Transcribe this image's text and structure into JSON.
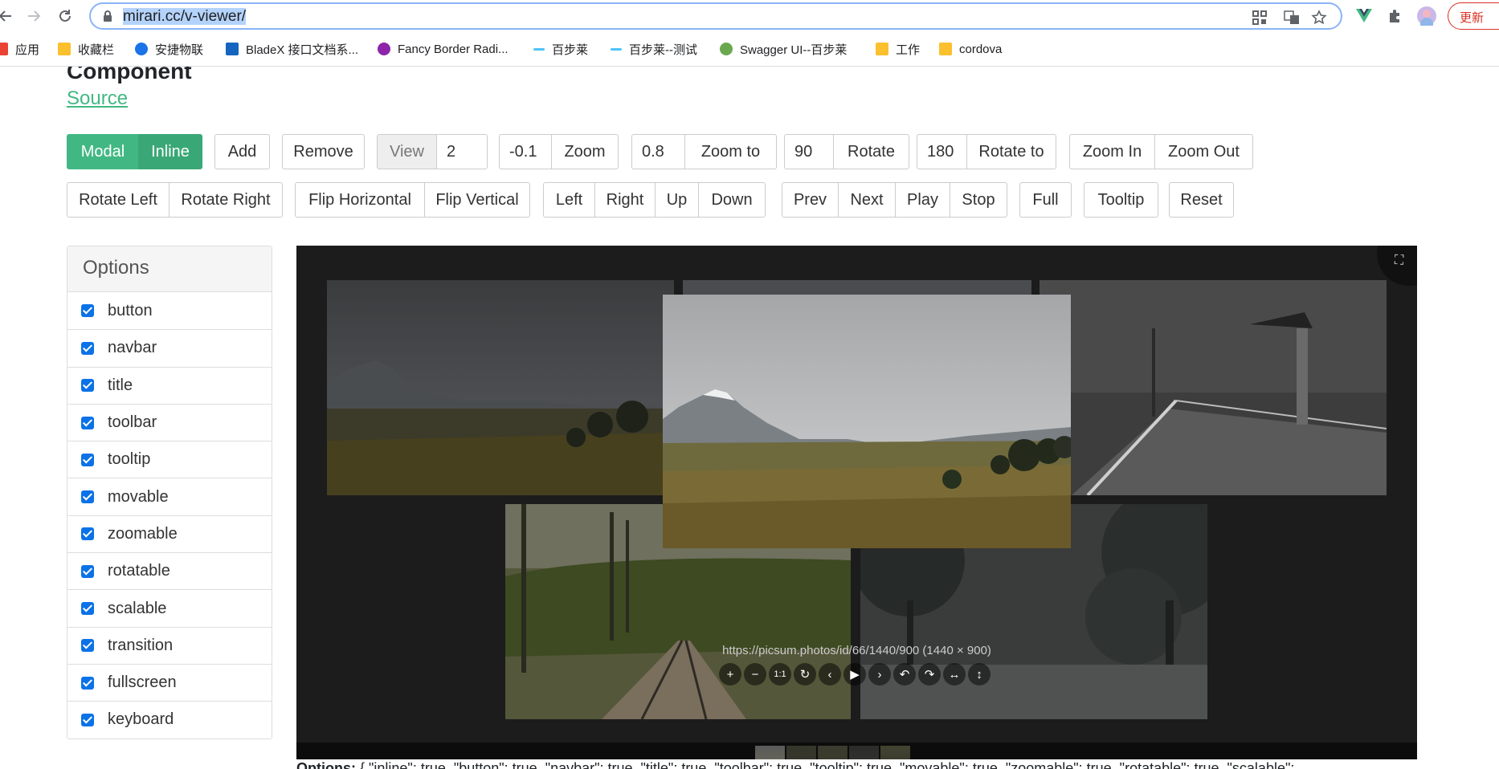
{
  "browser": {
    "url": "mirari.cc/v-viewer/",
    "update_label": "更新",
    "bookmarks": [
      {
        "label": "应用",
        "icon": "apps-grid-icon",
        "color": "#ea4335"
      },
      {
        "label": "收藏栏",
        "icon": "folder-icon",
        "color": "#fbc02d"
      },
      {
        "label": "安捷物联",
        "icon": "circle-logo-icon",
        "color": "#1a73e8"
      },
      {
        "label": "BladeX 接口文档系...",
        "icon": "bladex-icon",
        "color": "#1565c0"
      },
      {
        "label": "Fancy Border Radi...",
        "icon": "blob-icon",
        "color": "#8e24aa"
      },
      {
        "label": "百步莱",
        "icon": "dash-icon",
        "color": "#4fc3f7"
      },
      {
        "label": "百步莱--测试",
        "icon": "dash-icon",
        "color": "#4fc3f7"
      },
      {
        "label": "Swagger UI--百步莱",
        "icon": "swagger-icon",
        "color": "#6aa84f"
      },
      {
        "label": "工作",
        "icon": "folder-icon",
        "color": "#fbc02d"
      },
      {
        "label": "cordova",
        "icon": "folder-icon",
        "color": "#fbc02d"
      }
    ]
  },
  "page": {
    "heading": "Component",
    "source_link": "Source"
  },
  "buttons_row1": {
    "mode_modal": "Modal",
    "mode_inline": "Inline",
    "add": "Add",
    "remove": "Remove",
    "view_addon": "View",
    "view_value": "2",
    "zoom_value": "-0.1",
    "zoom": "Zoom",
    "zoom_to_value": "0.8",
    "zoom_to": "Zoom to",
    "rotate_value": "90",
    "rotate": "Rotate",
    "rotate_to_value": "180",
    "rotate_to": "Rotate to",
    "zoom_in": "Zoom In",
    "zoom_out": "Zoom Out"
  },
  "buttons_row2": {
    "rotate_left": "Rotate Left",
    "rotate_right": "Rotate Right",
    "flip_horizontal": "Flip Horizontal",
    "flip_vertical": "Flip Vertical",
    "left": "Left",
    "right": "Right",
    "up": "Up",
    "down": "Down",
    "prev": "Prev",
    "next": "Next",
    "play": "Play",
    "stop": "Stop",
    "full": "Full",
    "tooltip": "Tooltip",
    "reset": "Reset"
  },
  "options": {
    "heading": "Options",
    "items": [
      {
        "label": "button",
        "checked": true
      },
      {
        "label": "navbar",
        "checked": true
      },
      {
        "label": "title",
        "checked": true
      },
      {
        "label": "toolbar",
        "checked": true
      },
      {
        "label": "tooltip",
        "checked": true
      },
      {
        "label": "movable",
        "checked": true
      },
      {
        "label": "zoomable",
        "checked": true
      },
      {
        "label": "rotatable",
        "checked": true
      },
      {
        "label": "scalable",
        "checked": true
      },
      {
        "label": "transition",
        "checked": true
      },
      {
        "label": "fullscreen",
        "checked": true
      },
      {
        "label": "keyboard",
        "checked": true
      }
    ]
  },
  "viewer": {
    "title": "https://picsum.photos/id/66/1440/900 (1440 × 900)",
    "thumbnail_count": 5,
    "active_thumbnail": 1
  },
  "options_json": {
    "label": "Options:",
    "text": " { \"inline\": true, \"button\": true, \"navbar\": true, \"title\": true, \"toolbar\": true, \"tooltip\": true, \"movable\": true, \"zoomable\": true, \"rotatable\": true, \"scalable\":"
  }
}
